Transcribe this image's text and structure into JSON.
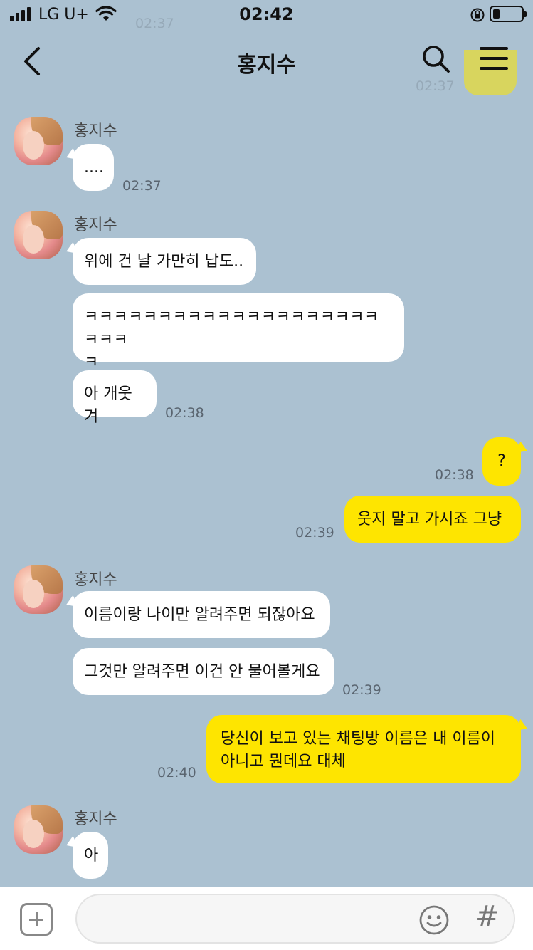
{
  "status": {
    "carrier": "LG U+",
    "time": "02:42"
  },
  "header": {
    "title": "홍지수"
  },
  "ghost": {
    "time1": "02:37",
    "time2": "02:37"
  },
  "messages": [
    {
      "dir": "in",
      "sender": "홍지수",
      "text": "....",
      "time": "02:37"
    },
    {
      "dir": "in",
      "sender": "홍지수",
      "text": "위에 건 날 가만히 납도..",
      "time": ""
    },
    {
      "dir": "in",
      "text": "ㅋㅋㅋㅋㅋㅋㅋㅋㅋㅋㅋㅋㅋㅋㅋㅋㅋㅋㅋㅋㅋㅋㅋ\nㅋ",
      "time": ""
    },
    {
      "dir": "in",
      "text": "아 개웃겨",
      "time": "02:38"
    },
    {
      "dir": "out",
      "text": "?",
      "time": "02:38"
    },
    {
      "dir": "out",
      "text": "웃지 말고 가시죠 그냥",
      "time": "02:39"
    },
    {
      "dir": "in",
      "sender": "홍지수",
      "text": "이름이랑 나이만 알려주면 되잖아요",
      "time": ""
    },
    {
      "dir": "in",
      "text": "그것만 알려주면 이건 안 물어볼게요",
      "time": "02:39"
    },
    {
      "dir": "out",
      "text": "당신이 보고 있는 채팅방 이름은 내 이름이\n아니고 뭔데요 대체",
      "time": "02:40"
    },
    {
      "dir": "in",
      "sender": "홍지수",
      "text": "아",
      "time": ""
    }
  ],
  "input": {
    "placeholder": "",
    "value": ""
  },
  "colors": {
    "background": "#abc1d1",
    "incoming": "#ffffff",
    "outgoing": "#fee500"
  },
  "icons": [
    "signal-icon",
    "wifi-icon",
    "orientation-lock-icon",
    "battery-icon",
    "back-icon",
    "search-icon",
    "menu-icon",
    "plus-icon",
    "emoji-icon",
    "hash-icon"
  ]
}
